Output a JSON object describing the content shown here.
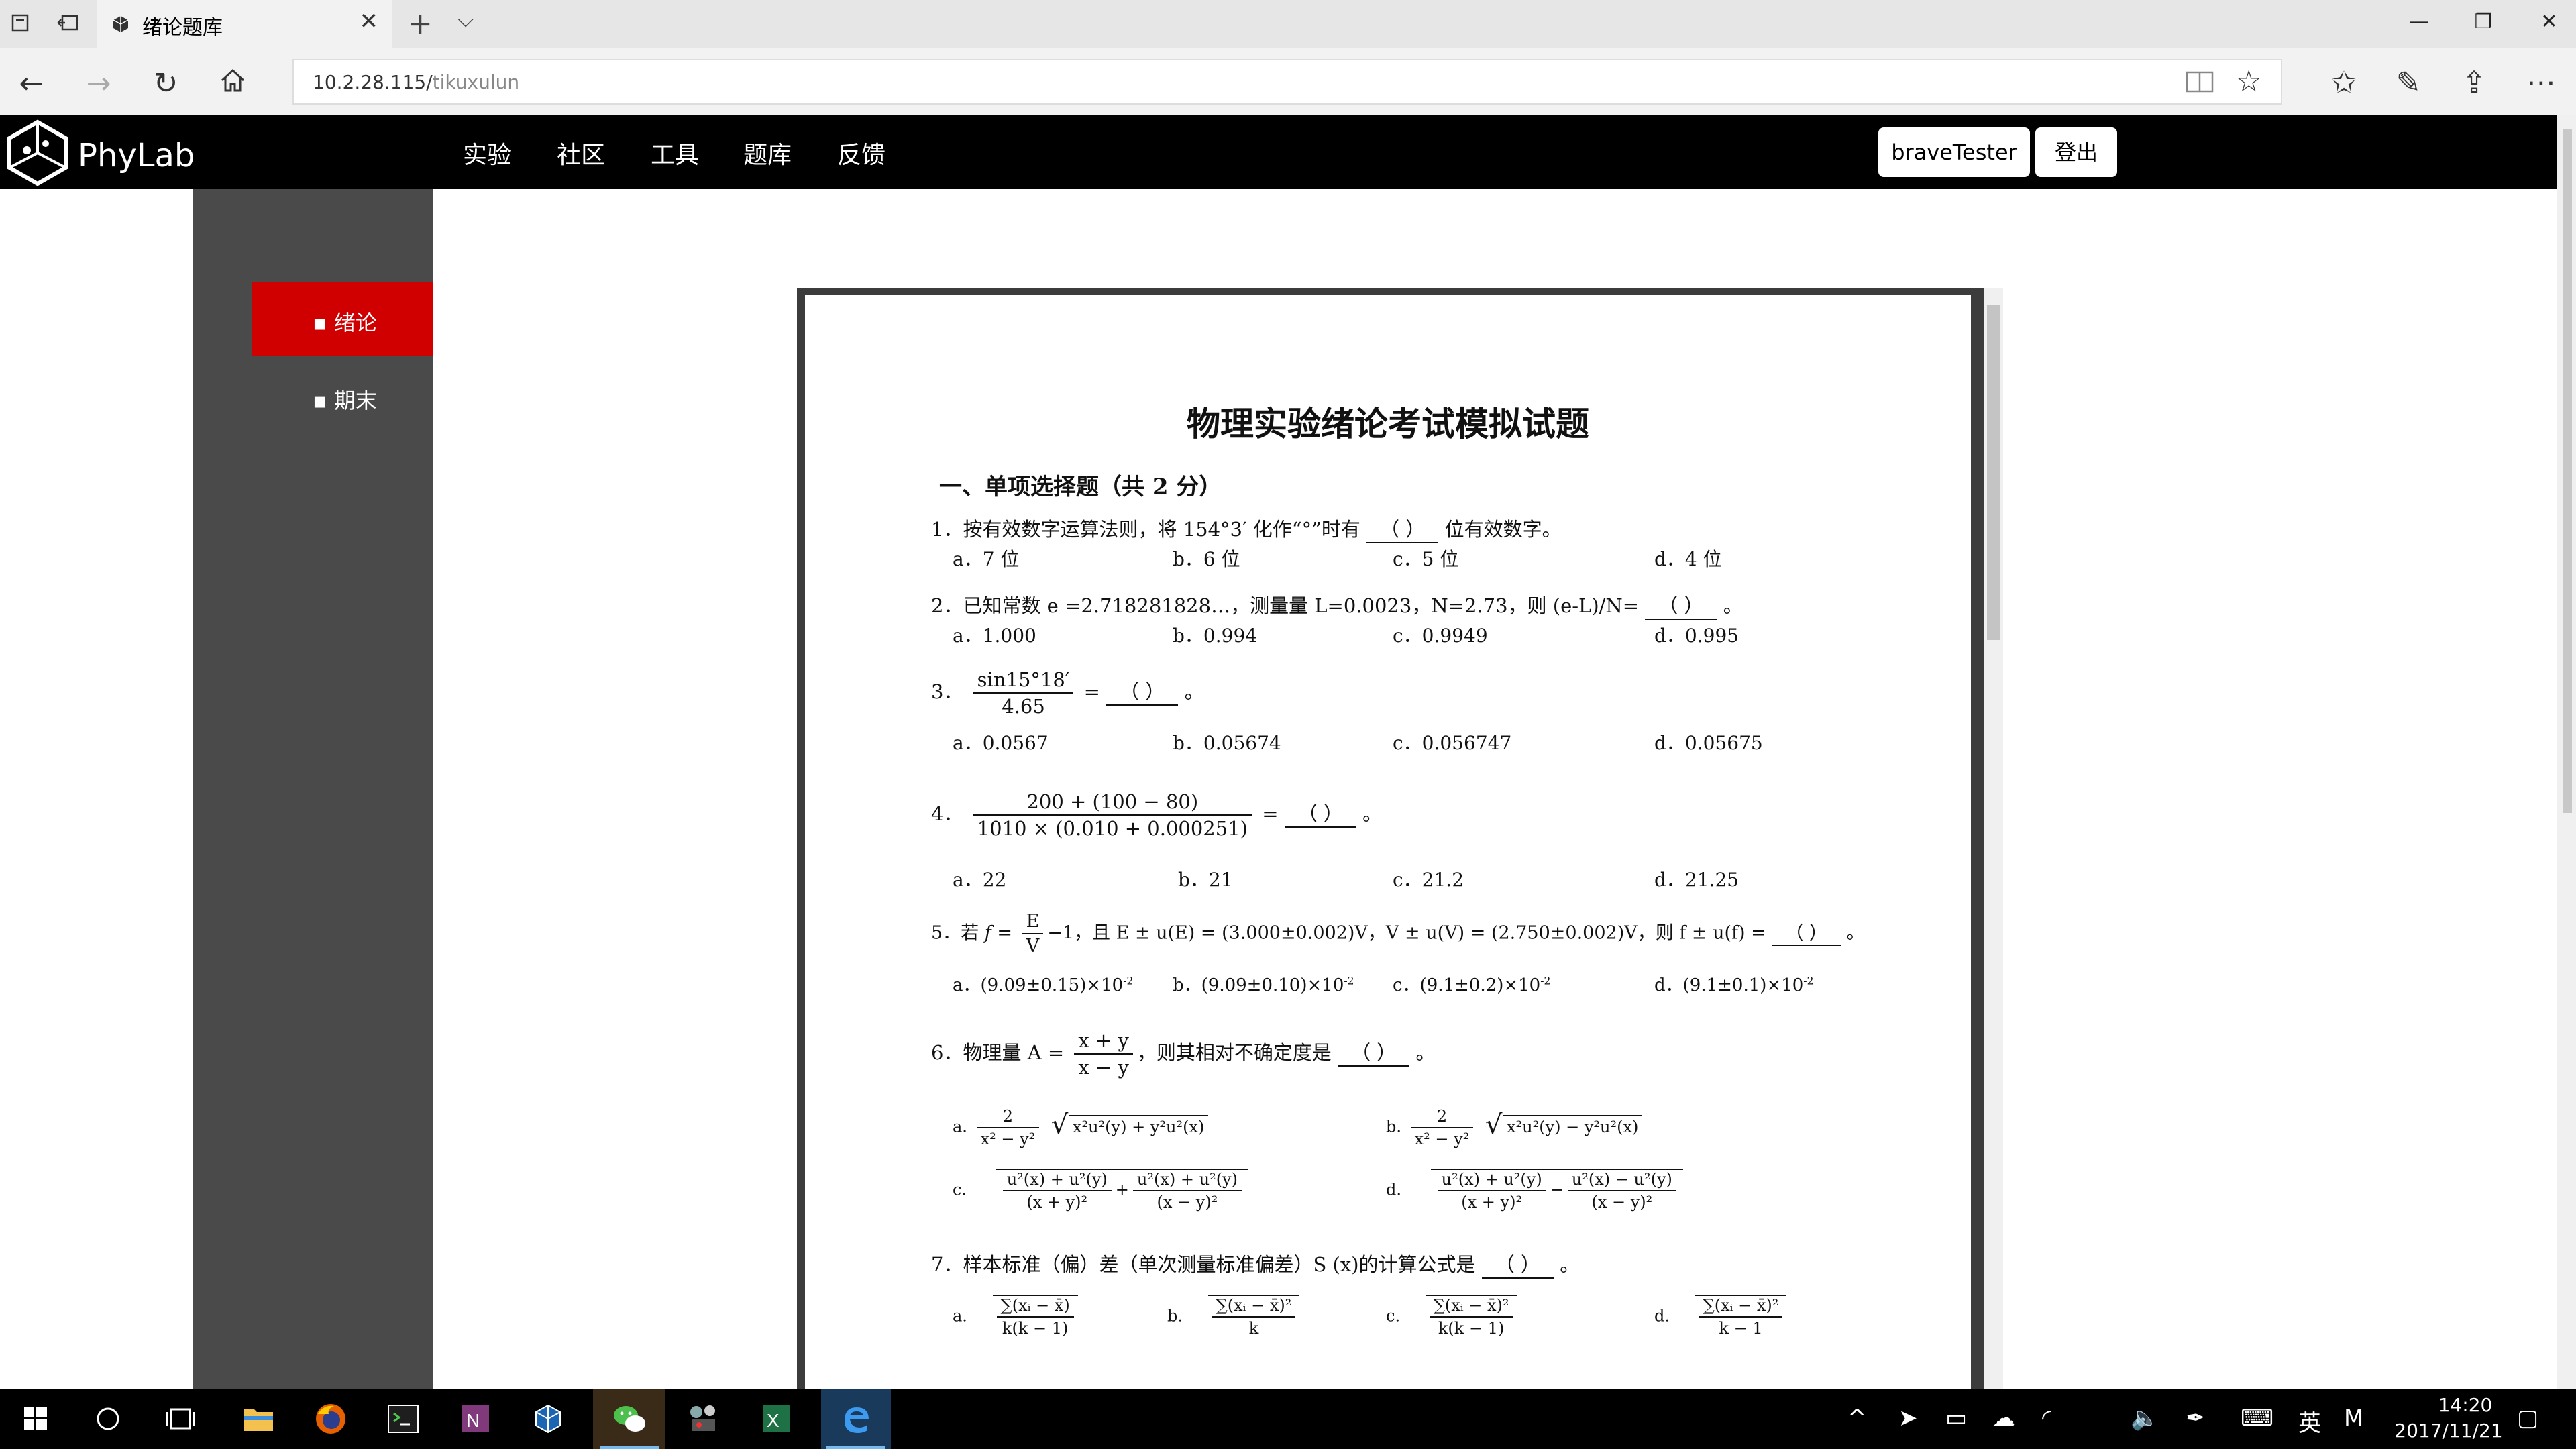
{
  "browser": {
    "tab_title": "绪论题库",
    "url_host": "10.2.28.115/",
    "url_path": "tikuxulun"
  },
  "site": {
    "logo_text": "PhyLab",
    "nav": [
      "实验",
      "社区",
      "工具",
      "题库",
      "反馈"
    ],
    "user_button": "braveTester",
    "logout_button": "登出"
  },
  "sidebar": {
    "items": [
      {
        "label": "▪ 绪论",
        "active": true
      },
      {
        "label": "▪ 期末",
        "active": false
      }
    ]
  },
  "document": {
    "title": "物理实验绪论考试模拟试题",
    "section": "一、单项选择题（共 2 分）",
    "q1": {
      "text": "1．按有效数字运算法则，将 154°3′ 化作“°”时有",
      "blank": "（      ）",
      "after": "位有效数字。",
      "options": [
        "a．7 位",
        "b．6 位",
        "c．5 位",
        "d．4 位"
      ]
    },
    "q2": {
      "text": "2．已知常数 e =2.718281828…，测量量 L=0.0023，N=2.73，则 (e-L)/N=",
      "blank": "（      ）",
      "after": "。",
      "options": [
        "a．1.000",
        "b．0.994",
        "c．0.9949",
        "d．0.995"
      ]
    },
    "q3": {
      "num": "3．",
      "frac_num": "sin15°18′",
      "frac_den": "4.65",
      "blank": "（      ）",
      "after": "。",
      "options": [
        "a．0.0567",
        "b．0.05674",
        "c．0.056747",
        "d．0.05675"
      ]
    },
    "q4": {
      "num": "4．",
      "frac_num": "200 + (100 − 80)",
      "frac_den": "1010 × (0.010 + 0.000251)",
      "blank": "（      ）",
      "after": "。",
      "options": [
        "a．22",
        "b．21",
        "c．21.2",
        "d．21.25"
      ]
    },
    "q5": {
      "num": "5．若",
      "f_eq": "f =",
      "frac_num": "E",
      "frac_den": "V",
      "mid": "−1，且 E ± u(E) = (3.000±0.002)V，V ± u(V) = (2.750±0.002)V，则 f ± u(f) =",
      "blank": "（      ）",
      "after": "。",
      "options": [
        "a．(9.09±0.15)×10",
        "b．(9.09±0.10)×10",
        "c．(9.1±0.2)×10",
        "d．(9.1±0.1)×10"
      ],
      "exponent": "-2"
    },
    "q6": {
      "num": "6．物理量 A =",
      "frac_num": "x + y",
      "frac_den": "x − y",
      "mid": "，则其相对不确定度是",
      "blank": "（      ）",
      "after": "。",
      "opt_labels": [
        "a.",
        "b.",
        "c.",
        "d."
      ],
      "ab_num": "2",
      "ab_den": "x² − y²",
      "a_root": "x²u²(y) + y²u²(x)",
      "b_root": "x²u²(y) − y²u²(x)",
      "cd_num": "u²(x) + u²(y)",
      "cd_den1": "(x + y)²",
      "cd_num2_c": "u²(x) + u²(y)",
      "cd_num2_d": "u²(x) − u²(y)",
      "cd_den2": "(x − y)²",
      "plus": "+",
      "minus": "−"
    },
    "q7": {
      "text": "7．样本标准（偏）差（单次测量标准偏差）S (x)的计算公式是",
      "blank": "（      ）",
      "after": "。",
      "opt_labels": [
        "a.",
        "b.",
        "c.",
        "d."
      ],
      "a_num": "∑(xᵢ − x̄)",
      "a_den": "k(k − 1)",
      "b_num": "∑(xᵢ − x̄)²",
      "b_den": "k",
      "c_num": "∑(xᵢ − x̄)²",
      "c_den": "k(k − 1)",
      "d_num": "∑(xᵢ − x̄)²",
      "d_den": "k − 1"
    }
  },
  "taskbar": {
    "ime_lang": "英",
    "ime_mode": "M",
    "time": "14:20",
    "date": "2017/11/21"
  },
  "colors": {
    "accent_red": "#d10000",
    "sidebar_gray": "#4a4a4a",
    "header_black": "#000000"
  }
}
